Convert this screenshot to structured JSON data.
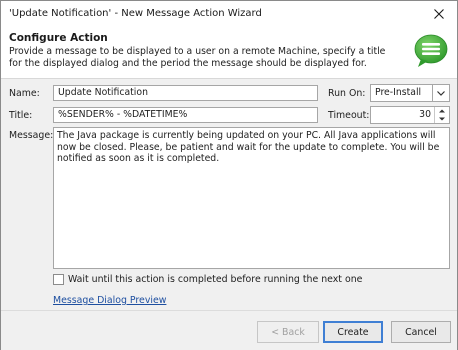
{
  "window": {
    "title": "'Update Notification' - New Message Action Wizard"
  },
  "header": {
    "heading": "Configure Action",
    "description": "Provide a message to be displayed to a user on a remote Machine, specify a title for the displayed dialog and the period the message should be displayed for.",
    "icon": "message-bubble-icon",
    "icon_color": "#3fae3a"
  },
  "form": {
    "name_label": "Name:",
    "name_value": "Update Notification",
    "run_on_label": "Run On:",
    "run_on_value": "Pre-Install",
    "title_label": "Title:",
    "title_value": "%SENDER% - %DATETIME%",
    "timeout_label": "Timeout:",
    "timeout_value": "30",
    "message_label": "Message:",
    "message_value": "The Java package is currently being updated on your PC. All Java applications will now be closed. Please, be patient and wait for the update to complete. You will be notified as soon as it is completed.",
    "wait_checkbox_label": "Wait until this action is completed before running the next one",
    "wait_checked": false,
    "preview_link": "Message Dialog Preview"
  },
  "buttons": {
    "back": "< Back",
    "create": "Create",
    "cancel": "Cancel"
  }
}
